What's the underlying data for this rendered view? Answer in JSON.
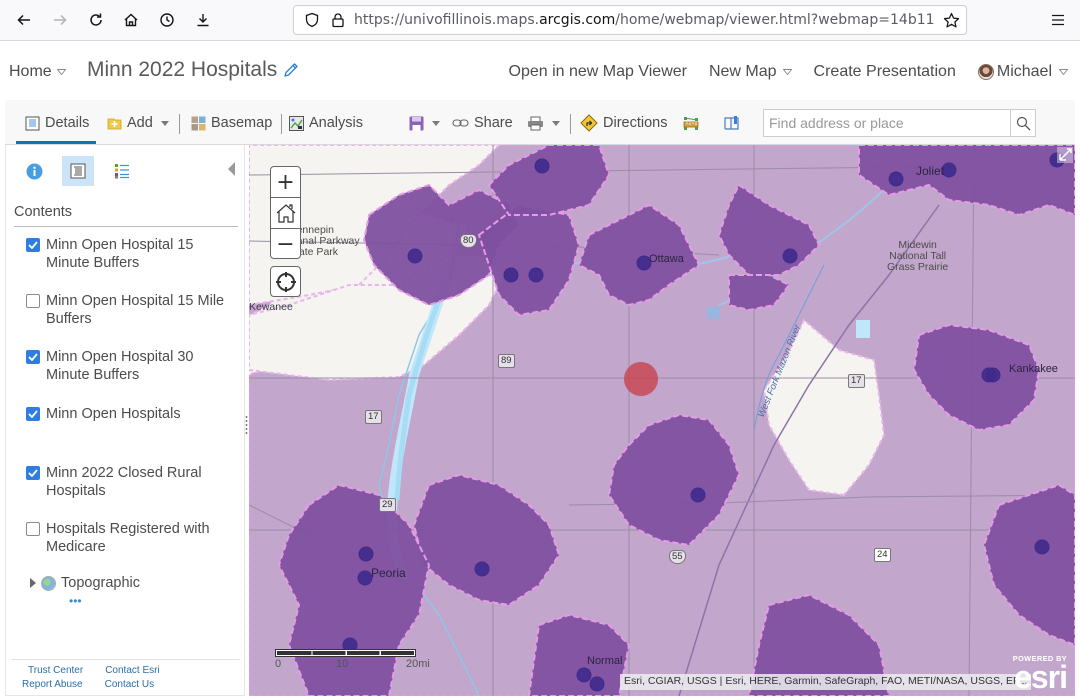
{
  "browser": {
    "url_prefix": "https://univofillinois.maps.",
    "url_host": "arcgis.com",
    "url_path": "/home/webmap/viewer.html?webmap=14b11",
    "icons": [
      "back-icon",
      "forward-icon",
      "reload-icon",
      "home-icon",
      "history-icon",
      "download-icon",
      "shield-icon",
      "lock-icon",
      "star-icon",
      "menu-icon"
    ]
  },
  "header": {
    "home_label": "Home",
    "map_title": "Minn 2022 Hospitals",
    "open_new_viewer": "Open in new Map Viewer",
    "new_map": "New Map",
    "create_presentation": "Create Presentation",
    "user_name": "Michael"
  },
  "toolbar": {
    "details": "Details",
    "add": "Add",
    "basemap": "Basemap",
    "analysis": "Analysis",
    "share": "Share",
    "directions": "Directions",
    "search_placeholder": "Find address or place"
  },
  "sidebar": {
    "contents_label": "Contents",
    "layers": [
      {
        "name": "Minn Open Hospital 15 Minute Buffers",
        "checked": true
      },
      {
        "name": "Minn Open Hospital 15 Mile Buffers",
        "checked": false
      },
      {
        "name": "Minn Open Hospital 30 Minute Buffers",
        "checked": true
      },
      {
        "name": "Minn Open Hospitals",
        "checked": true
      },
      {
        "name": "Minn 2022 Closed Rural Hospitals",
        "checked": true
      },
      {
        "name": "Hospitals Registered with Medicare",
        "checked": false
      }
    ],
    "basemap_name": "Topographic",
    "more_label": "•••",
    "footer": {
      "trust_center": "Trust Center",
      "contact_esri": "Contact Esri",
      "report_abuse": "Report Abuse",
      "contact_us": "Contact Us"
    }
  },
  "map": {
    "zoom_in": "+",
    "zoom_out": "−",
    "colors": {
      "buffer_30min": "#c2a6cc",
      "buffer_15min": "#8050a0",
      "hospital_point": "#3f2a8c",
      "closed_hospital": "#c8424e",
      "buffer_outline": "#e79be6"
    },
    "labels": {
      "hennepin": "Hennepin\nCanal Parkway\nState Park",
      "kewanee": "Kewanee",
      "ottawa": "Ottawa",
      "joliet": "Joliet",
      "midewin": "Midewin\nNational Tall\nGrass Prairie",
      "kankakee": "Kankakee",
      "peoria": "Peoria",
      "normal": "Normal",
      "river": "West Fork Mazon River"
    },
    "shields": {
      "i80": "80",
      "r89": "89",
      "r17a": "17",
      "r17b": "17",
      "r29": "29",
      "i55": "55",
      "us24": "24"
    },
    "scalebar": {
      "t0": "0",
      "t10": "10",
      "t20": "20mi"
    },
    "attribution": "Esri, CGIAR, USGS | Esri, HERE, Garmin, SafeGraph, FAO, METI/NASA, USGS, EP...",
    "esri_powered_by": "POWERED BY",
    "esri_word": "esri"
  }
}
